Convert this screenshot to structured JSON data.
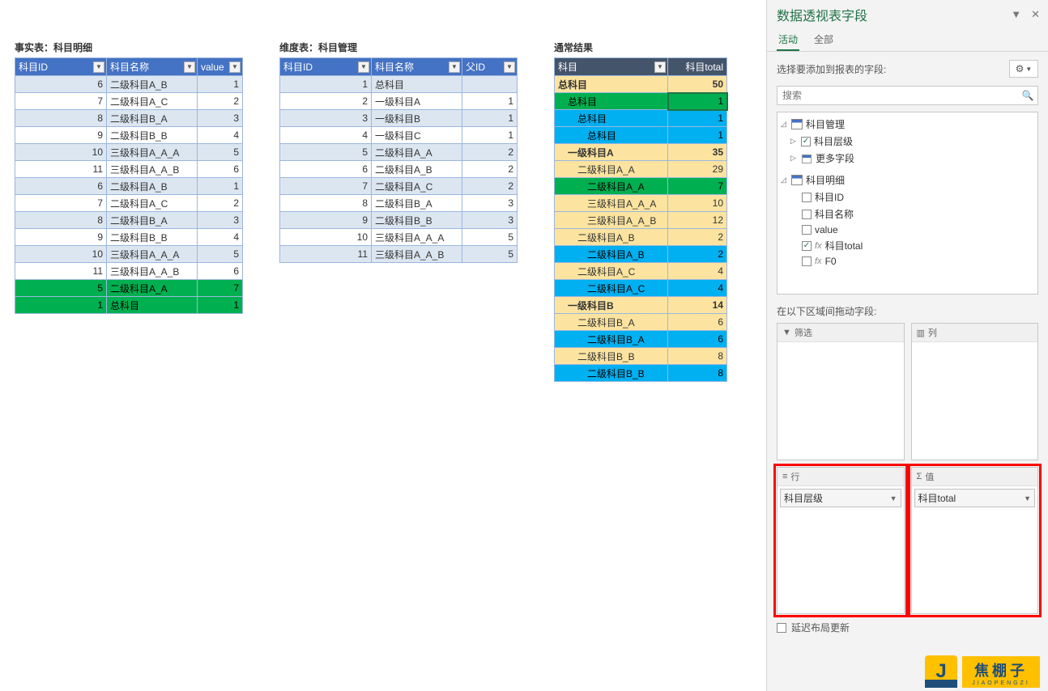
{
  "titles": {
    "fact": "事实表：科目明细",
    "dim": "维度表：科目管理",
    "result": "通常结果"
  },
  "fact_table": {
    "cols": [
      "科目ID",
      "科目名称",
      "value"
    ],
    "rows": [
      {
        "id": 6,
        "name": "二级科目A_B",
        "val": 1,
        "cls": "even"
      },
      {
        "id": 7,
        "name": "二级科目A_C",
        "val": 2,
        "cls": "odd"
      },
      {
        "id": 8,
        "name": "二级科目B_A",
        "val": 3,
        "cls": "even"
      },
      {
        "id": 9,
        "name": "二级科目B_B",
        "val": 4,
        "cls": "odd"
      },
      {
        "id": 10,
        "name": "三级科目A_A_A",
        "val": 5,
        "cls": "even"
      },
      {
        "id": 11,
        "name": "三级科目A_A_B",
        "val": 6,
        "cls": "odd"
      },
      {
        "id": 6,
        "name": "二级科目A_B",
        "val": 1,
        "cls": "even"
      },
      {
        "id": 7,
        "name": "二级科目A_C",
        "val": 2,
        "cls": "odd"
      },
      {
        "id": 8,
        "name": "二级科目B_A",
        "val": 3,
        "cls": "even"
      },
      {
        "id": 9,
        "name": "二级科目B_B",
        "val": 4,
        "cls": "odd"
      },
      {
        "id": 10,
        "name": "三级科目A_A_A",
        "val": 5,
        "cls": "even"
      },
      {
        "id": 11,
        "name": "三级科目A_A_B",
        "val": 6,
        "cls": "odd"
      },
      {
        "id": 5,
        "name": "二级科目A_A",
        "val": 7,
        "cls": "green"
      },
      {
        "id": 1,
        "name": "总科目",
        "val": 1,
        "cls": "green"
      }
    ]
  },
  "dim_table": {
    "cols": [
      "科目ID",
      "科目名称",
      "父ID"
    ],
    "rows": [
      {
        "id": 1,
        "name": "总科目",
        "pid": "",
        "cls": "even"
      },
      {
        "id": 2,
        "name": "一级科目A",
        "pid": 1,
        "cls": "odd"
      },
      {
        "id": 3,
        "name": "一级科目B",
        "pid": 1,
        "cls": "even"
      },
      {
        "id": 4,
        "name": "一级科目C",
        "pid": 1,
        "cls": "odd"
      },
      {
        "id": 5,
        "name": "二级科目A_A",
        "pid": 2,
        "cls": "even"
      },
      {
        "id": 6,
        "name": "二级科目A_B",
        "pid": 2,
        "cls": "odd"
      },
      {
        "id": 7,
        "name": "二级科目A_C",
        "pid": 2,
        "cls": "even"
      },
      {
        "id": 8,
        "name": "二级科目B_A",
        "pid": 3,
        "cls": "odd"
      },
      {
        "id": 9,
        "name": "二级科目B_B",
        "pid": 3,
        "cls": "even"
      },
      {
        "id": 10,
        "name": "三级科目A_A_A",
        "pid": 5,
        "cls": "odd"
      },
      {
        "id": 11,
        "name": "三级科目A_A_B",
        "pid": 5,
        "cls": "even"
      }
    ]
  },
  "pivot": {
    "cols": [
      "科目",
      "科目total"
    ],
    "rows": [
      {
        "name": "总科目",
        "val": 50,
        "cls": "pv-h0",
        "pad": 0,
        "sel": false,
        "bold": true
      },
      {
        "name": "总科目",
        "val": 1,
        "cls": "pv-green",
        "pad": 1,
        "sel": true
      },
      {
        "name": "总科目",
        "val": 1,
        "cls": "pv-blue",
        "pad": 2
      },
      {
        "name": "总科目",
        "val": 1,
        "cls": "pv-blue",
        "pad": 3
      },
      {
        "name": "一级科目A",
        "val": 35,
        "cls": "pv-tan",
        "pad": 1,
        "bold": true
      },
      {
        "name": "二级科目A_A",
        "val": 29,
        "cls": "pv-tan",
        "pad": 2
      },
      {
        "name": "二级科目A_A",
        "val": 7,
        "cls": "pv-green",
        "pad": 3
      },
      {
        "name": "三级科目A_A_A",
        "val": 10,
        "cls": "pv-tan",
        "pad": 3
      },
      {
        "name": "三级科目A_A_B",
        "val": 12,
        "cls": "pv-tan",
        "pad": 3
      },
      {
        "name": "二级科目A_B",
        "val": 2,
        "cls": "pv-tan",
        "pad": 2
      },
      {
        "name": "二级科目A_B",
        "val": 2,
        "cls": "pv-blue",
        "pad": 3
      },
      {
        "name": "二级科目A_C",
        "val": 4,
        "cls": "pv-tan",
        "pad": 2
      },
      {
        "name": "二级科目A_C",
        "val": 4,
        "cls": "pv-blue",
        "pad": 3
      },
      {
        "name": "一级科目B",
        "val": 14,
        "cls": "pv-tan",
        "pad": 1,
        "bold": true
      },
      {
        "name": "二级科目B_A",
        "val": 6,
        "cls": "pv-tan",
        "pad": 2
      },
      {
        "name": "二级科目B_A",
        "val": 6,
        "cls": "pv-blue",
        "pad": 3
      },
      {
        "name": "二级科目B_B",
        "val": 8,
        "cls": "pv-tan",
        "pad": 2
      },
      {
        "name": "二级科目B_B",
        "val": 8,
        "cls": "pv-blue",
        "pad": 3
      }
    ]
  },
  "pane": {
    "title": "数据透视表字段",
    "tabs": {
      "active": "活动",
      "all": "全部"
    },
    "sub": "选择要添加到报表的字段:",
    "search_ph": "搜索",
    "fields": {
      "t1_name": "科目管理",
      "t1_f1": "科目层级",
      "t1_more": "更多字段",
      "t2_name": "科目明细",
      "t2_f1": "科目ID",
      "t2_f2": "科目名称",
      "t2_f3": "value",
      "t2_f4": "科目total",
      "t2_f5": "F0"
    },
    "areas_title": "在以下区域间拖动字段:",
    "area_labels": {
      "filters": "筛选",
      "cols": "列",
      "rows": "行",
      "vals": "值"
    },
    "row_pill": "科目层级",
    "val_pill": "科目total",
    "defer": "延迟布局更新"
  },
  "logo": {
    "cn": "焦棚子",
    "en": "JIAOPENGZI",
    "initial": "J"
  }
}
